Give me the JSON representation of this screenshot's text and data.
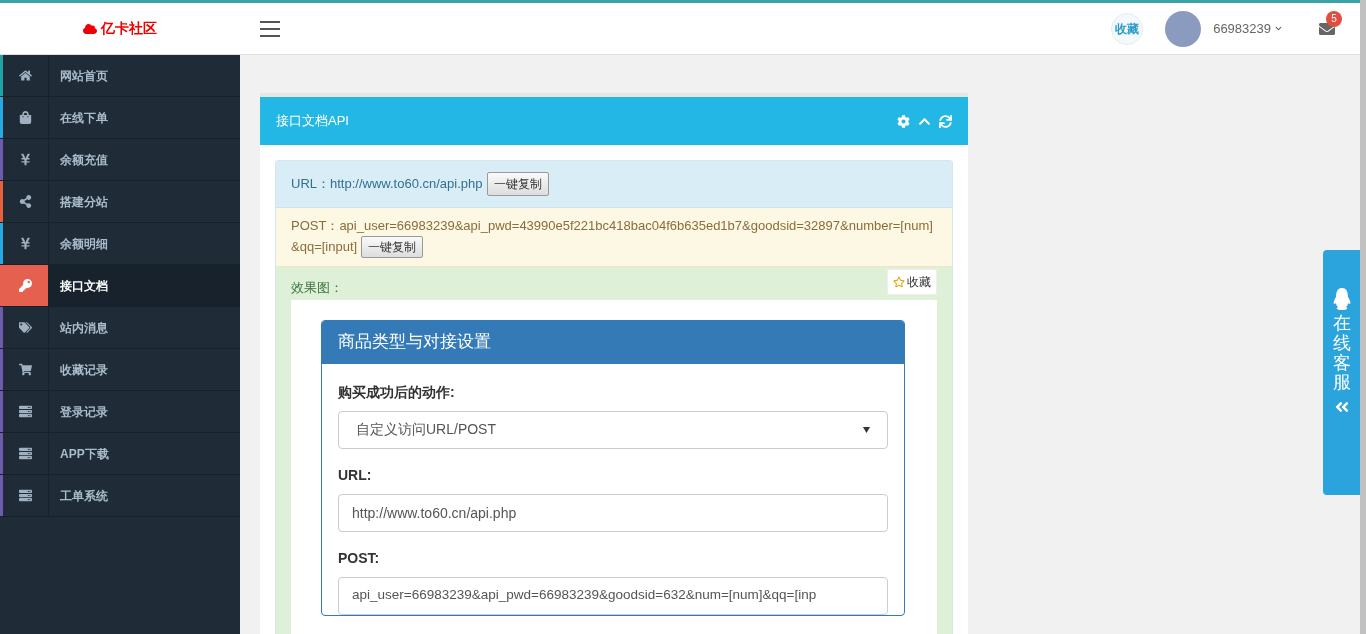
{
  "header": {
    "logo": "亿卡社区",
    "favorite_logo": "收藏",
    "username": "66983239",
    "mail_badge": "5"
  },
  "sidebar": {
    "items": [
      {
        "label": "网站首页",
        "selected": false,
        "color": "#1fa5a5"
      },
      {
        "label": "在线下单",
        "selected": false,
        "color": "#27a9e1"
      },
      {
        "label": "余额充值",
        "selected": false,
        "color": "#6d5cae"
      },
      {
        "label": "搭建分站",
        "selected": false,
        "color": "#e5603b"
      },
      {
        "label": "余额明细",
        "selected": false,
        "color": "#27a9e1"
      },
      {
        "label": "接口文档",
        "selected": true,
        "color": "#e5604e"
      },
      {
        "label": "站内消息",
        "selected": false,
        "color": "#6d5cae"
      },
      {
        "label": "收藏记录",
        "selected": false,
        "color": "#6d5cae"
      },
      {
        "label": "登录记录",
        "selected": false,
        "color": "#6d5cae"
      },
      {
        "label": "APP下载",
        "selected": false,
        "color": "#6d5cae"
      },
      {
        "label": "工单系统",
        "selected": false,
        "color": "#6d5cae"
      }
    ]
  },
  "panel": {
    "title": "接口文档API",
    "url_line": "URL：http://www.to60.cn/api.php",
    "copy_button": "一键复制",
    "post_line": "POST：api_user=66983239&api_pwd=43990e5f221bc418bac04f6b635ed1b7&goodsid=32897&number=[num]&qq=[input]",
    "post_copy_button": "一键复制",
    "preview_label": "效果图：",
    "favorite_button": "收藏",
    "preview": {
      "title": "商品类型与对接设置",
      "action_label": "购买成功后的动作:",
      "action_value": "自定义访问URL/POST",
      "url_label": "URL:",
      "url_value": "http://www.to60.cn/api.php",
      "post_label": "POST:",
      "post_value": "api_user=66983239&api_pwd=66983239&goodsid=632&num=[num]&qq=[inp"
    }
  },
  "support_tab": {
    "label": "在线客服"
  }
}
